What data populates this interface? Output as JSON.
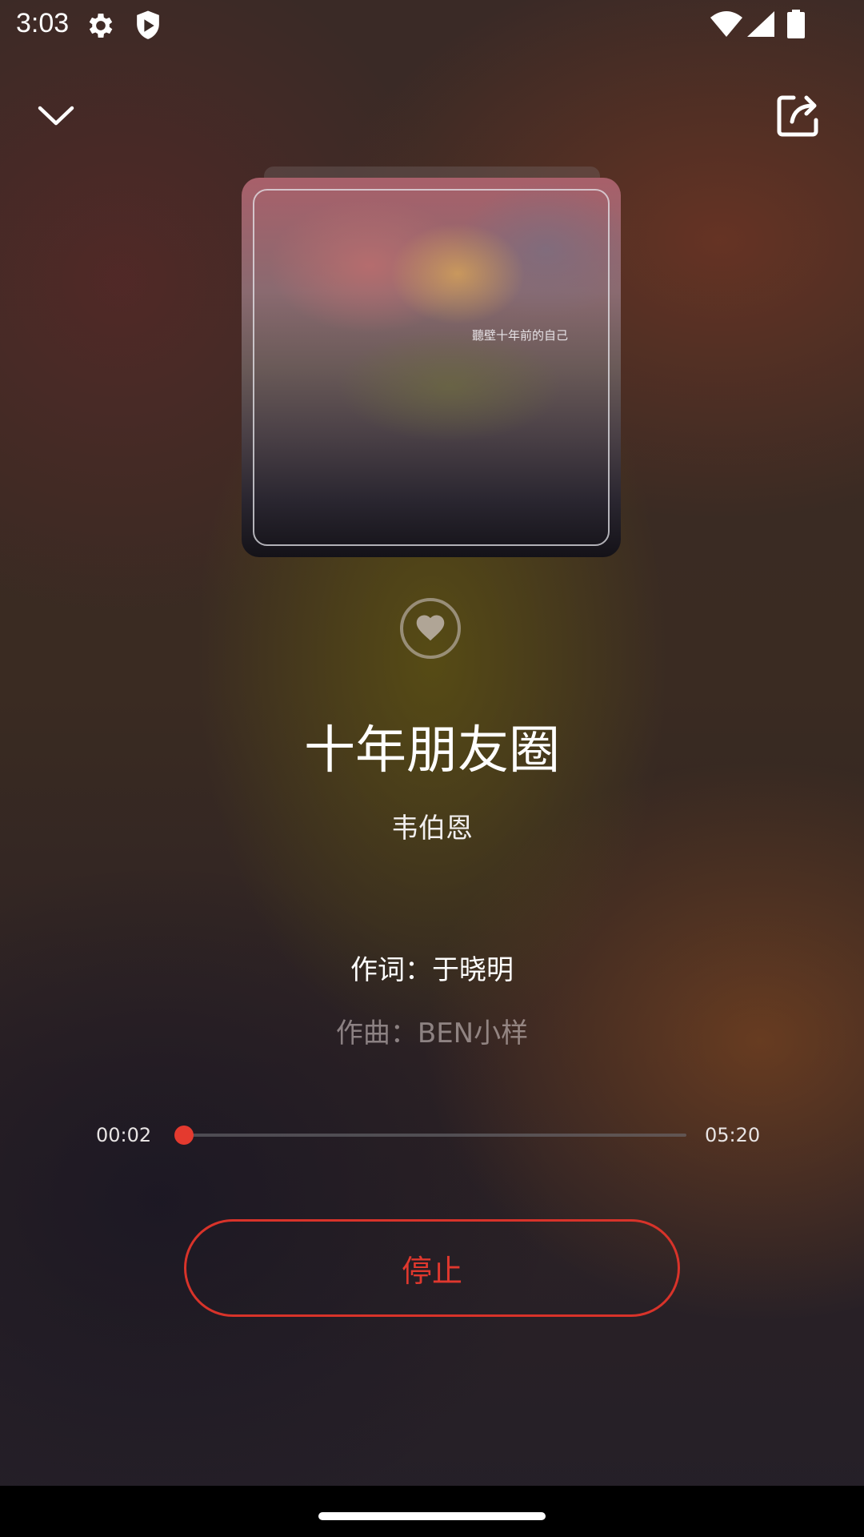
{
  "status_bar": {
    "time": "3:03",
    "left_icons": [
      "settings-icon",
      "shield-icon"
    ],
    "right_icons": [
      "wifi-icon",
      "signal-icon",
      "battery-icon"
    ]
  },
  "header": {
    "collapse_icon": "chevron-down-icon",
    "share_icon": "share-icon"
  },
  "album": {
    "cover_text": "聽壁十年前的自己"
  },
  "song": {
    "title": "十年朋友圈",
    "artist": "韦伯恩"
  },
  "lyrics": {
    "line1": "作词：于晓明",
    "line2": "作曲：BEN小样"
  },
  "player": {
    "current_time": "00:02",
    "total_time": "05:20",
    "progress_fraction": 0.006,
    "stop_label": "停止"
  },
  "colors": {
    "accent": "#e43a2f"
  }
}
